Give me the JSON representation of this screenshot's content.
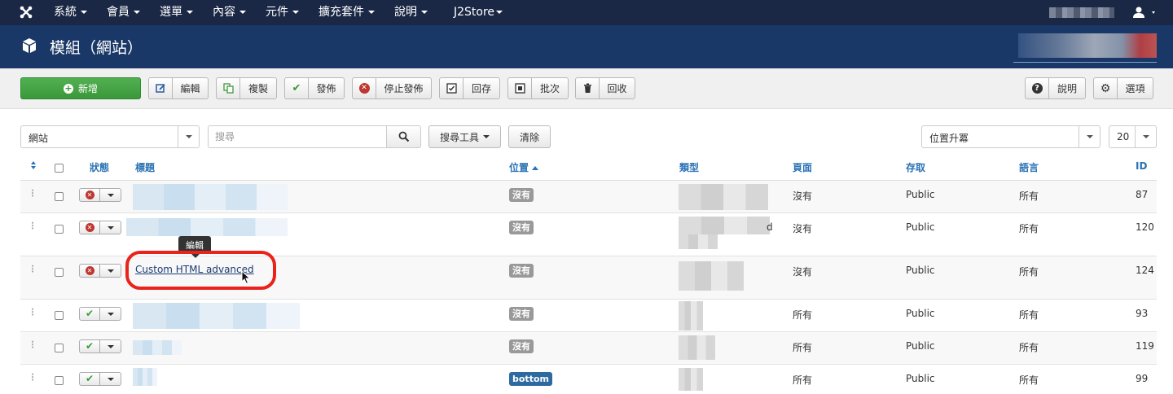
{
  "navbar": {
    "menu": [
      "系統",
      "會員",
      "選單",
      "內容",
      "元件",
      "擴充套件",
      "說明",
      "J2Store"
    ]
  },
  "header": {
    "title": "模組（網站）"
  },
  "toolbar": {
    "new_label": "新增",
    "buttons": [
      "編輯",
      "複製",
      "發佈",
      "停止發佈",
      "回存",
      "批次",
      "回收"
    ],
    "help_label": "說明",
    "options_label": "選項"
  },
  "filters": {
    "client": "網站",
    "search_placeholder": "搜尋",
    "search_tools": "搜尋工具",
    "clear": "清除",
    "sort": "位置升冪",
    "limit": "20"
  },
  "table": {
    "headers": {
      "status": "狀態",
      "title": "標題",
      "position": "位置",
      "type": "類型",
      "pages": "頁面",
      "access": "存取",
      "language": "語言",
      "id": "ID"
    },
    "rows": [
      {
        "published": false,
        "position": "沒有",
        "pages": "沒有",
        "access": "Public",
        "language": "所有",
        "id": "87"
      },
      {
        "published": false,
        "position": "沒有",
        "pages": "沒有",
        "access": "Public",
        "language": "所有",
        "id": "120",
        "type_tail": "d"
      },
      {
        "published": false,
        "title": "Custom HTML advanced",
        "position": "沒有",
        "pages": "沒有",
        "access": "Public",
        "language": "所有",
        "id": "124"
      },
      {
        "published": true,
        "position": "沒有",
        "pages": "所有",
        "access": "Public",
        "language": "所有",
        "id": "93"
      },
      {
        "published": true,
        "position": "沒有",
        "pages": "所有",
        "access": "Public",
        "language": "所有",
        "id": "119"
      },
      {
        "published": true,
        "position": "bottom",
        "pages": "所有",
        "access": "Public",
        "language": "所有",
        "id": "99"
      }
    ]
  },
  "tooltip": "編輯",
  "colors": {
    "navbar": "#1b2845",
    "header": "#1a3867",
    "accent_link": "#2a72b5",
    "new_button": "#46a546",
    "highlight": "#e8231b"
  }
}
